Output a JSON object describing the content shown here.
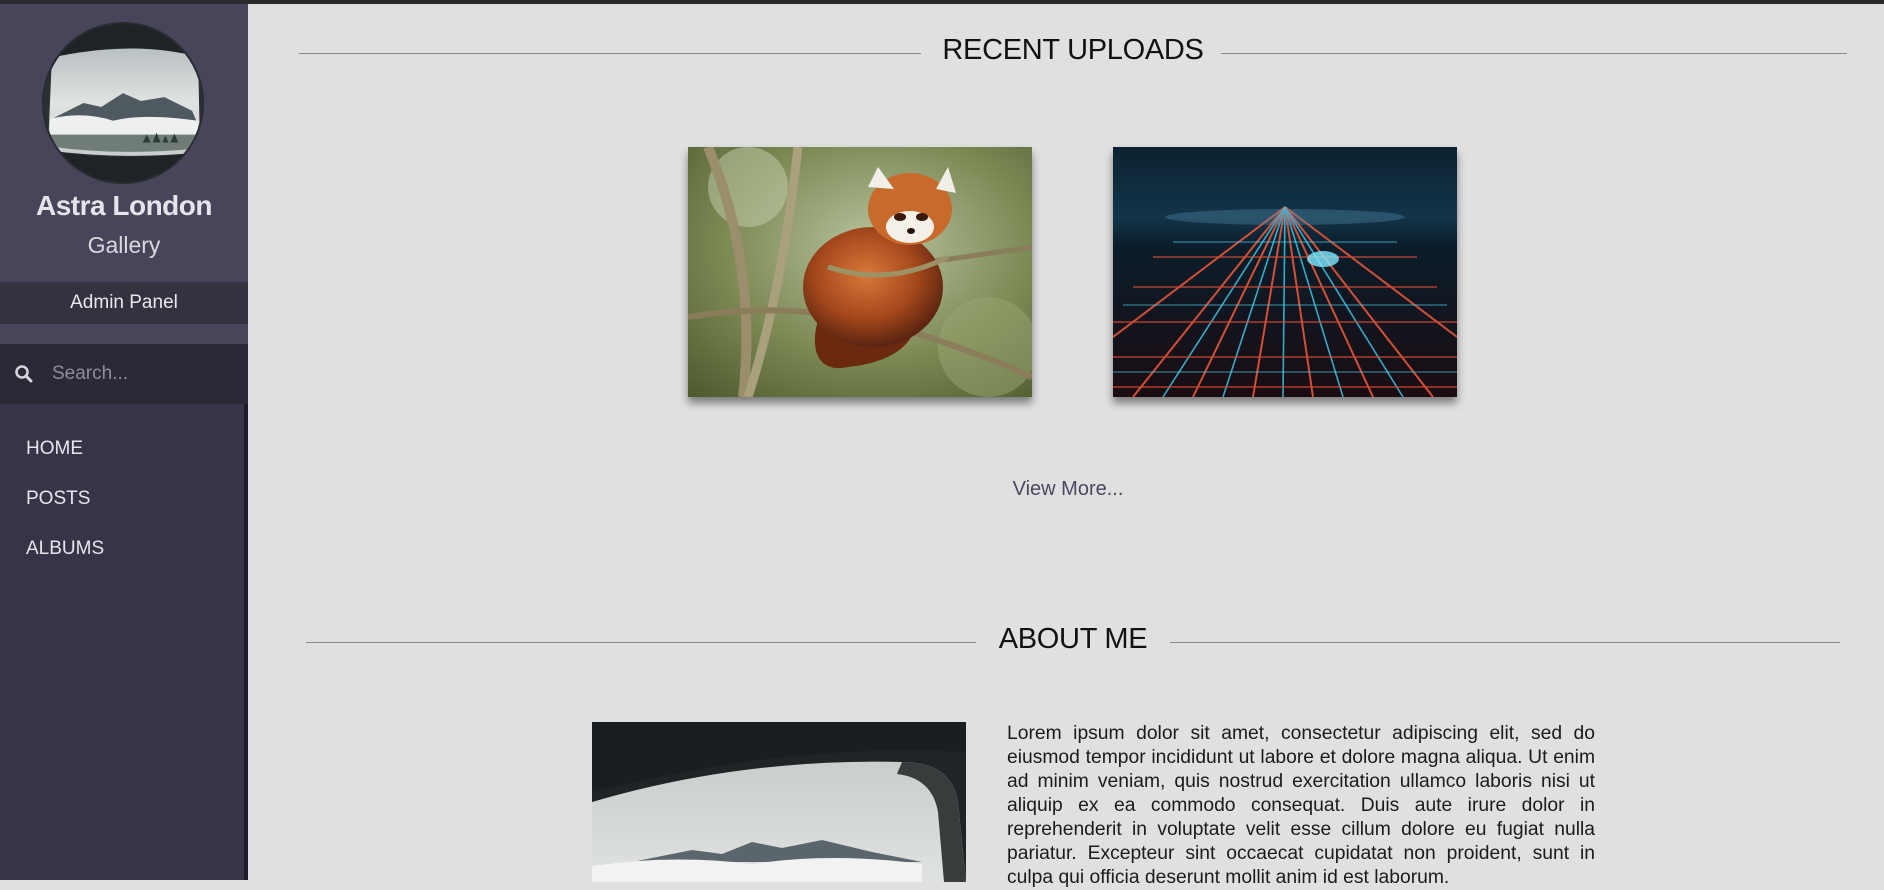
{
  "sidebar": {
    "name": "Astra London",
    "subtitle": "Gallery",
    "admin_panel": "Admin Panel",
    "search_placeholder": "Search...",
    "nav": [
      {
        "label": "HOME"
      },
      {
        "label": "POSTS"
      },
      {
        "label": "ALBUMS"
      }
    ]
  },
  "recent": {
    "title": "RECENT UPLOADS",
    "photos": [
      {
        "subject": "red-panda-in-tree"
      },
      {
        "subject": "city-lights-at-night"
      }
    ],
    "view_more": "View More..."
  },
  "about": {
    "title": "ABOUT ME",
    "text": "Lorem ipsum dolor sit amet, consectetur adipiscing elit, sed do eiusmod tempor incididunt ut labore et dolore magna aliqua. Ut enim ad minim veniam, quis nostrud exercitation ullamco laboris nisi ut aliquip ex ea commodo consequat. Duis aute irure dolor in reprehenderit in voluptate velit esse cillum dolore eu fugiat nulla pariatur. Excepteur sint occaecat cupidatat non proident, sunt in culpa qui officia deserunt mollit anim id est laborum."
  },
  "colors": {
    "sidebar_bg": "#363447",
    "profile_bg": "#474559",
    "page_bg": "#e0e0e0",
    "link": "#4a4860"
  }
}
